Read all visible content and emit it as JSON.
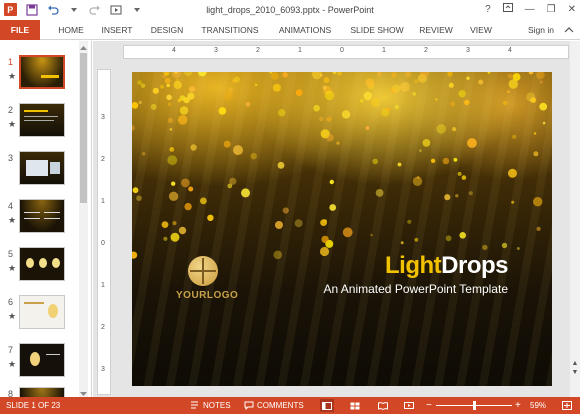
{
  "window": {
    "title": "light_drops_2010_6093.pptx - PowerPoint",
    "help": "?",
    "minimize": "—",
    "restore": "❐",
    "close": "✕"
  },
  "ribbon": {
    "tabs": [
      "FILE",
      "HOME",
      "INSERT",
      "DESIGN",
      "TRANSITIONS",
      "ANIMATIONS",
      "SLIDE SHOW",
      "REVIEW",
      "VIEW"
    ],
    "sign_in": "Sign in"
  },
  "thumbnails": [
    {
      "num": "1",
      "star": "★"
    },
    {
      "num": "2",
      "star": "★"
    },
    {
      "num": "3",
      "star": ""
    },
    {
      "num": "4",
      "star": "★"
    },
    {
      "num": "5",
      "star": "★"
    },
    {
      "num": "6",
      "star": "★"
    },
    {
      "num": "7",
      "star": "★"
    },
    {
      "num": "8",
      "star": ""
    }
  ],
  "ruler": {
    "horizontal": [
      "4",
      "3",
      "2",
      "1",
      "0",
      "1",
      "2",
      "3",
      "4"
    ],
    "vertical": [
      "3",
      "2",
      "1",
      "0",
      "1",
      "2",
      "3"
    ]
  },
  "slide": {
    "title_part1": "Light",
    "title_part2": "Drops",
    "subtitle": "An Animated PowerPoint Template",
    "logo_text": "YOURLOGO"
  },
  "status": {
    "slide_info": "SLIDE 1 OF 23",
    "notes": "NOTES",
    "comments": "COMMENTS",
    "zoom": "59%",
    "zoom_minus": "−",
    "zoom_plus": "+"
  },
  "colors": {
    "accent": "#d24726",
    "title_gold": "#f2c200"
  }
}
